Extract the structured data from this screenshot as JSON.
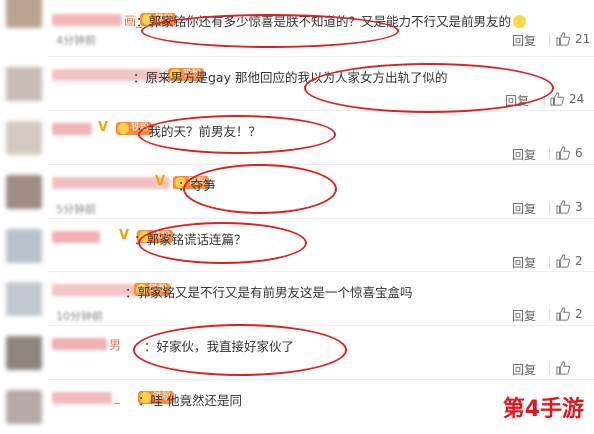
{
  "comments": [
    {
      "name_tail": "画_",
      "has_v": false,
      "fan_label": "铁粉",
      "text": "：郭家铭你还有多少惊喜是朕不知道的？又是能力不行又是前男友的",
      "has_emoji": true,
      "date": "4分钟前",
      "reply": "回复",
      "likes": "21",
      "avatar_color": "#b9a392",
      "name_color": "#f2b8b8"
    },
    {
      "name_tail": "涯咿",
      "has_v": false,
      "fan_label": "铁粉",
      "text": "：原来男方是gay 那他回应的我以为人家女方出轨了似的",
      "has_emoji": false,
      "date": "",
      "reply": "回复",
      "likes": "24",
      "avatar_color": "#c7bcb6",
      "name_color": "#f4c4c4"
    },
    {
      "name_tail": "",
      "has_v": true,
      "fan_label": "铁粉",
      "text": "：我的天？前男友！？",
      "has_emoji": false,
      "date": "",
      "reply": "回复",
      "likes": "6",
      "avatar_color": "#d4c9c2",
      "name_color": "#f0b4b4"
    },
    {
      "name_tail": "院",
      "has_v": true,
      "fan_label": "铁粉",
      "text": "：夺笋",
      "has_emoji": false,
      "date": "5分钟前",
      "reply": "回复",
      "likes": "3",
      "avatar_color": "#9e8c82",
      "name_color": "#f2c0c0"
    },
    {
      "name_tail": "",
      "has_v": true,
      "fan_label": "铁粉",
      "text": "：郭家铭谎话连篇？",
      "has_emoji": false,
      "date": "",
      "reply": "回复",
      "likes": "2",
      "avatar_color": "#b8c2cc",
      "name_color": "#f0b0b0"
    },
    {
      "name_tail": "",
      "has_v": false,
      "fan_label": "铁粉",
      "text": "：郭家铭又是不行又是有前男友这是一个惊喜宝盒吗",
      "has_emoji": false,
      "date": "10分钟前",
      "reply": "回复",
      "likes": "2",
      "avatar_color": "#c3c8d0",
      "name_color": "#f4c4c4"
    },
    {
      "name_tail": "男",
      "has_v": false,
      "fan_label": "",
      "text": "：好家伙，我直接好家伙了",
      "has_emoji": false,
      "date": "",
      "reply": "回复",
      "likes": "",
      "avatar_color": "#8f8580",
      "name_color": "#f0b0b0"
    },
    {
      "name_tail": "_",
      "has_v": false,
      "fan_label": "铁粉",
      "text": "：哇 他竟然还是同",
      "has_emoji": false,
      "date": "",
      "reply": "",
      "likes": "",
      "avatar_color": "#b5aaa8",
      "name_color": "#f2bcbc"
    }
  ],
  "watermark": "第4手游",
  "accent_red": "#e0201f",
  "icons": {
    "like": "thumbs-up-icon",
    "v_badge": "vip-v-badge",
    "fan_badge": "fan-badge-icon"
  }
}
